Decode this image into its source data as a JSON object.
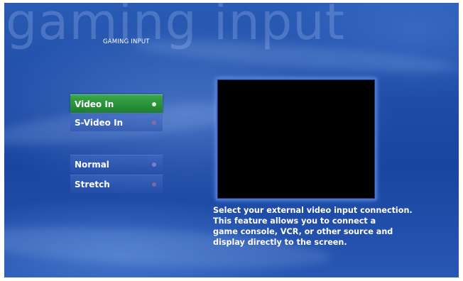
{
  "background_title": "gaming input",
  "page_title": "GAMING INPUT",
  "input_options": [
    {
      "label": "Video In",
      "selected": true
    },
    {
      "label": "S-Video In",
      "selected": false
    }
  ],
  "display_options": [
    {
      "label": "Normal",
      "selected": true
    },
    {
      "label": "Stretch",
      "selected": false
    }
  ],
  "description_lines": [
    "Select your external video input connection.",
    "This feature allows you to connect a",
    "game console, VCR, or other source and",
    "display directly to the screen."
  ],
  "colors": {
    "background": "#1e4ca6",
    "selected_button": "#2a9a3c",
    "preview_border": "#4a74d0",
    "preview_fill": "#000000"
  }
}
